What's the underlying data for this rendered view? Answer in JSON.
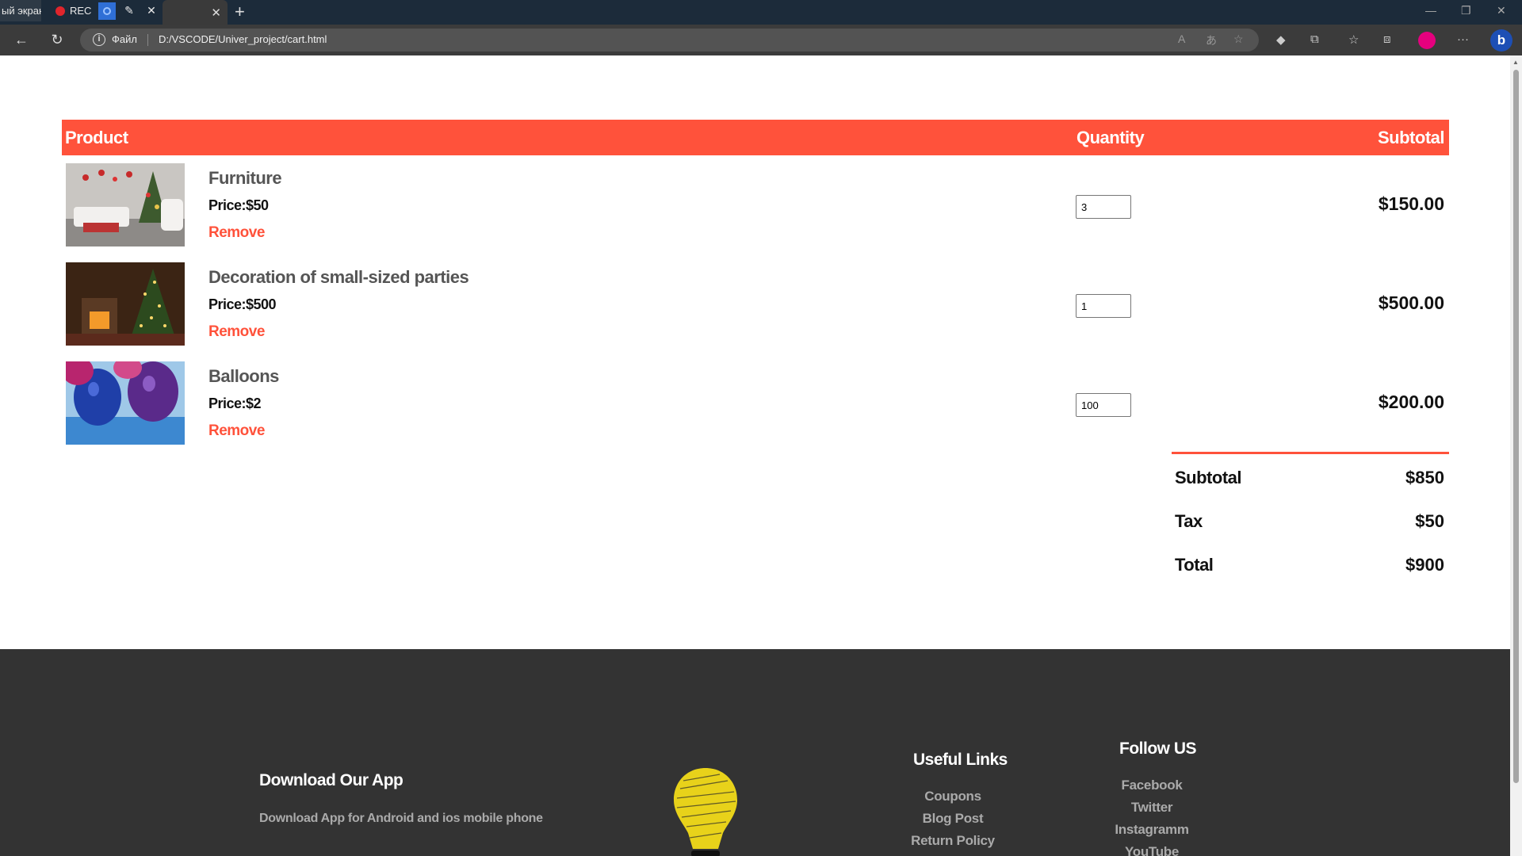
{
  "browser": {
    "tabs": {
      "screen_label": "ый экран",
      "rec_label": "REC"
    },
    "address_bar": {
      "scheme_label": "Файл",
      "url": "D:/VSCODE/Univer_project/cart.html"
    },
    "colors": {
      "accent": "#ff523b",
      "profile": "#e5007e",
      "bing": "#1d4fb5"
    }
  },
  "cart": {
    "headers": {
      "product": "Product",
      "quantity": "Quantity",
      "subtotal": "Subtotal"
    },
    "items": [
      {
        "name": "Furniture",
        "price": "Price:$50",
        "remove": "Remove",
        "quantity": "3",
        "subtotal": "$150.00"
      },
      {
        "name": "Decoration of small-sized parties",
        "price": "Price:$500",
        "remove": "Remove",
        "quantity": "1",
        "subtotal": "$500.00"
      },
      {
        "name": "Balloons",
        "price": "Price:$2",
        "remove": "Remove",
        "quantity": "100",
        "subtotal": "$200.00"
      }
    ],
    "totals": {
      "subtotal_label": "Subtotal",
      "subtotal_value": "$850",
      "tax_label": "Tax",
      "tax_value": "$50",
      "total_label": "Total",
      "total_value": "$900"
    }
  },
  "footer": {
    "app_title": "Download Our App",
    "app_desc": "Download App for Android and ios mobile phone",
    "links_title": "Useful Links",
    "links": [
      "Coupons",
      "Blog Post",
      "Return Policy"
    ],
    "follow_title": "Follow US",
    "follow": [
      "Facebook",
      "Twitter",
      "Instagramm",
      "YouTube"
    ]
  }
}
